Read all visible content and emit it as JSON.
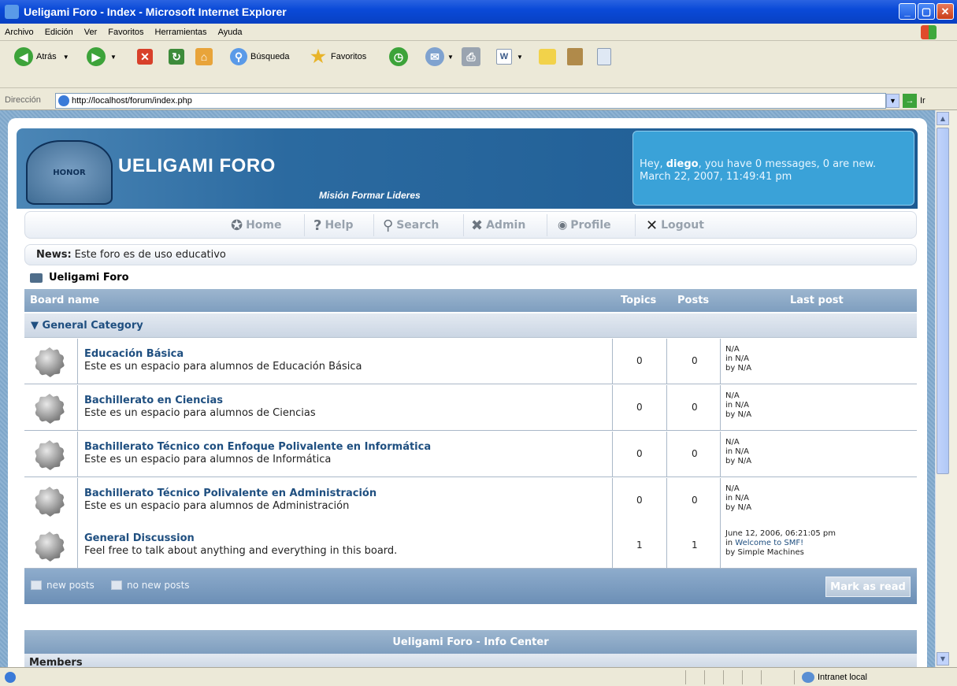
{
  "window": {
    "title": "Ueligami Foro - Index - Microsoft Internet Explorer"
  },
  "menu": [
    "Archivo",
    "Edición",
    "Ver",
    "Favoritos",
    "Herramientas",
    "Ayuda"
  ],
  "toolbar": {
    "back": "Atrás",
    "search": "Búsqueda",
    "favorites": "Favoritos"
  },
  "address": {
    "label": "Dirección",
    "url": "http://localhost/forum/index.php",
    "go": "Ir"
  },
  "header": {
    "logo_text": "HONOR",
    "site_title": "UELIGAMI FORO",
    "slogan": "Misión Formar Lideres",
    "greeting_pre": "Hey, ",
    "user": "diego",
    "greeting_post": ", you have 0 messages, 0 are new.",
    "datetime": "March 22, 2007, 11:49:41 pm"
  },
  "nav": [
    {
      "label": "Home",
      "icon": "?"
    },
    {
      "label": "Help",
      "icon": "?"
    },
    {
      "label": "Search",
      "icon": "⚲"
    },
    {
      "label": "Admin",
      "icon": "✖"
    },
    {
      "label": "Profile",
      "icon": "◉"
    },
    {
      "label": "Logout",
      "icon": "✕"
    }
  ],
  "news": {
    "label": "News:",
    "text": "Este foro es de uso educativo"
  },
  "breadcrumb": "Ueligami Foro",
  "table": {
    "headers": {
      "board": "Board name",
      "topics": "Topics",
      "posts": "Posts",
      "last": "Last post"
    },
    "category": "▼ General Category",
    "boards": [
      {
        "name": "Educación Básica",
        "desc": "Este es un espacio para alumnos de Educación Básica",
        "topics": "0",
        "posts": "0",
        "lp1": "N/A",
        "lp2": "in N/A",
        "lp3": "by N/A"
      },
      {
        "name": "Bachillerato en Ciencias",
        "desc": "Este es un espacio para alumnos de Ciencias",
        "topics": "0",
        "posts": "0",
        "lp1": "N/A",
        "lp2": "in N/A",
        "lp3": "by N/A"
      },
      {
        "name": "Bachillerato Técnico con Enfoque Polivalente en Informática",
        "desc": "Este es un espacio para alumnos de Informática",
        "topics": "0",
        "posts": "0",
        "lp1": "N/A",
        "lp2": "in N/A",
        "lp3": "by N/A"
      },
      {
        "name": "Bachillerato Técnico Polivalente en Administración",
        "desc": "Este es un espacio para alumnos de Administración",
        "topics": "0",
        "posts": "0",
        "lp1": "N/A",
        "lp2": "in N/A",
        "lp3": "by N/A"
      },
      {
        "name": "General Discussion",
        "desc": "Feel free to talk about anything and everything in this board.",
        "topics": "1",
        "posts": "1",
        "lp1": "June 12, 2006, 06:21:05 pm",
        "lp2pre": "in ",
        "lp2link": "Welcome to SMF!",
        "lp3": "by Simple Machines"
      }
    ],
    "legend_new": "new posts",
    "legend_nonew": "no new posts",
    "mark_read": "Mark as read"
  },
  "info": {
    "title": "Ueligami Foro - Info Center",
    "members": "Members"
  },
  "status": {
    "zone": "Intranet local"
  }
}
